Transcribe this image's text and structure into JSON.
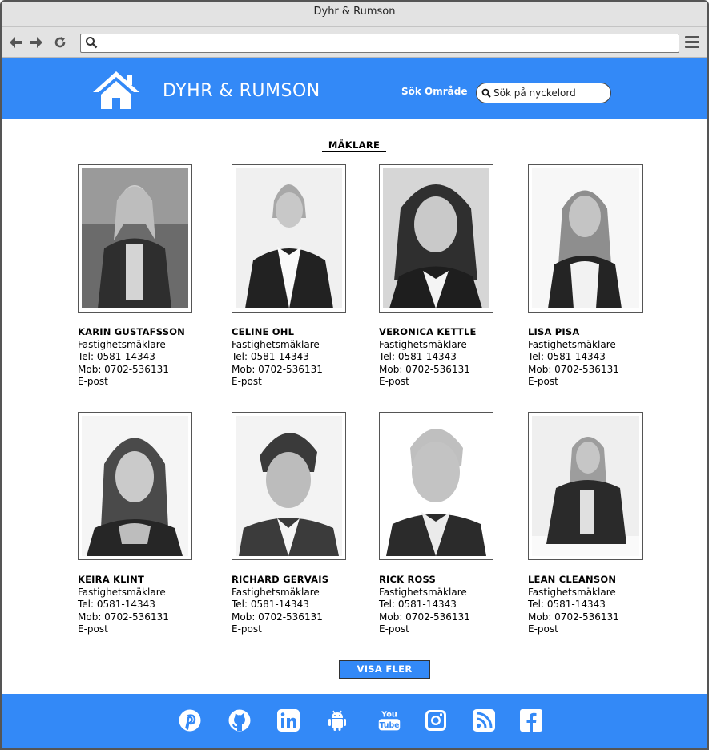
{
  "browser": {
    "title": "Dyhr & Rumson",
    "address": ""
  },
  "header": {
    "brand": "DYHR & RUMSON",
    "search_label": "Sök Område",
    "search_placeholder": "Sök på nyckelord"
  },
  "section": {
    "title": "MÄKLARE"
  },
  "agents": [
    {
      "name": "KARIN GUSTAFSSON",
      "role": "Fastighetsmäklare",
      "tel": "Tel: 0581-14343",
      "mob": "Mob: 0702-536131",
      "email": "E-post"
    },
    {
      "name": "CELINE OHL",
      "role": "Fastighetsmäklare",
      "tel": "Tel: 0581-14343",
      "mob": "Mob: 0702-536131",
      "email": "E-post"
    },
    {
      "name": "VERONICA KETTLE",
      "role": "Fastighetsmäklare",
      "tel": "Tel: 0581-14343",
      "mob": "Mob: 0702-536131",
      "email": "E-post"
    },
    {
      "name": "LISA PISA",
      "role": "Fastighetsmäklare",
      "tel": "Tel: 0581-14343",
      "mob": "Mob: 0702-536131",
      "email": "E-post"
    },
    {
      "name": "KEIRA KLINT",
      "role": "Fastighetsmäklare",
      "tel": "Tel: 0581-14343",
      "mob": "Mob: 0702-536131",
      "email": "E-post"
    },
    {
      "name": "RICHARD GERVAIS",
      "role": "Fastighetsmäklare",
      "tel": "Tel: 0581-14343",
      "mob": "Mob: 0702-536131",
      "email": "E-post"
    },
    {
      "name": "RICK ROSS",
      "role": "Fastighetsmäklare",
      "tel": "Tel: 0581-14343",
      "mob": "Mob: 0702-536131",
      "email": "E-post"
    },
    {
      "name": "LEAN CLEANSON",
      "role": "Fastighetsmäklare",
      "tel": "Tel: 0581-14343",
      "mob": "Mob: 0702-536131",
      "email": "E-post"
    }
  ],
  "show_more_label": "VISA FLER",
  "footer": {
    "social_icons": [
      "pinterest-icon",
      "github-icon",
      "linkedin-icon",
      "android-icon",
      "youtube-icon",
      "instagram-icon",
      "rss-icon",
      "facebook-icon"
    ],
    "youtube_you": "You",
    "youtube_tube": "Tube"
  },
  "colors": {
    "brand_blue": "#3389f7",
    "chrome_gray": "#e3e3e3"
  }
}
